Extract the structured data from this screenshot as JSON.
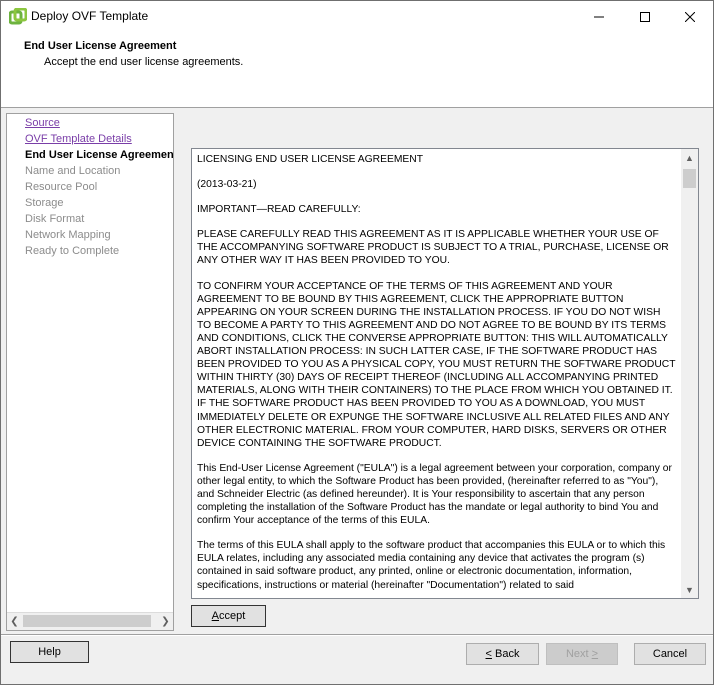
{
  "window": {
    "title": "Deploy OVF Template",
    "icons": {
      "app": "vsphere-logo-icon",
      "minimize": "minimize-icon",
      "maximize": "maximize-icon",
      "close": "close-icon"
    }
  },
  "header": {
    "title": "End User License Agreement",
    "subtitle": "Accept the end user license agreements."
  },
  "sidebar": {
    "items": [
      {
        "label": "Source",
        "state": "link"
      },
      {
        "label": "OVF Template Details",
        "state": "link"
      },
      {
        "label": "End User License Agreement",
        "state": "current"
      },
      {
        "label": "Name and Location",
        "state": "disabled"
      },
      {
        "label": "Resource Pool",
        "state": "disabled"
      },
      {
        "label": "Storage",
        "state": "disabled"
      },
      {
        "label": "Disk Format",
        "state": "disabled"
      },
      {
        "label": "Network Mapping",
        "state": "disabled"
      },
      {
        "label": "Ready to Complete",
        "state": "disabled"
      }
    ]
  },
  "eula": {
    "paragraphs": [
      "LICENSING END USER LICENSE AGREEMENT",
      "(2013-03-21)",
      "IMPORTANT—READ CAREFULLY:",
      "PLEASE CAREFULLY READ THIS AGREEMENT AS IT IS APPLICABLE WHETHER YOUR USE OF THE ACCOMPANYING SOFTWARE PRODUCT IS SUBJECT TO A TRIAL, PURCHASE, LICENSE OR ANY OTHER WAY IT HAS BEEN PROVIDED TO YOU.",
      "TO CONFIRM YOUR ACCEPTANCE OF THE TERMS OF THIS AGREEMENT AND YOUR AGREEMENT TO BE BOUND BY THIS AGREEMENT, CLICK THE APPROPRIATE BUTTON APPEARING ON YOUR SCREEN DURING THE INSTALLATION PROCESS. IF YOU DO NOT WISH TO BECOME A PARTY TO THIS AGREEMENT AND DO NOT AGREE TO BE BOUND BY ITS TERMS AND CONDITIONS, CLICK THE CONVERSE APPROPRIATE BUTTON: THIS WILL AUTOMATICALLY ABORT INSTALLATION PROCESS: IN SUCH LATTER CASE, IF THE SOFTWARE PRODUCT HAS BEEN PROVIDED TO YOU AS A PHYSICAL COPY, YOU MUST RETURN THE SOFTWARE PRODUCT WITHIN THIRTY (30) DAYS OF RECEIPT THEREOF (INCLUDING ALL ACCOMPANYING PRINTED MATERIALS, ALONG WITH THEIR CONTAINERS) TO THE PLACE FROM WHICH YOU OBTAINED IT. IF THE SOFTWARE PRODUCT HAS BEEN PROVIDED TO YOU AS A DOWNLOAD, YOU MUST IMMEDIATELY DELETE OR EXPUNGE THE SOFTWARE INCLUSIVE ALL RELATED FILES AND ANY OTHER ELECTRONIC MATERIAL. FROM YOUR COMPUTER, HARD DISKS, SERVERS OR OTHER DEVICE CONTAINING THE SOFTWARE PRODUCT.",
      "This End-User License Agreement (\"EULA\") is a legal agreement between your corporation, company or other legal entity, to which the Software Product has been provided, (hereinafter referred to as \"You\"), and Schneider Electric (as defined hereunder). It is Your responsibility to ascertain that any person completing the installation of the Software Product has the mandate or legal authority to bind You and confirm Your acceptance of the terms of this EULA.",
      "The terms of this EULA shall apply to the software product that accompanies this EULA or to which this EULA relates, including any associated media containing any device that activates the program (s) contained in said software product, any printed, online or electronic documentation, information, specifications, instructions or material (hereinafter \"Documentation\") related to said"
    ]
  },
  "buttons": {
    "accept_pre": "",
    "accept_u": "A",
    "accept_post": "ccept",
    "help": "Help",
    "back_u": "<",
    "back_post": " Back",
    "next_pre": "Next ",
    "next_u": ">",
    "cancel": "Cancel"
  },
  "colors": {
    "link": "#7a3ea8",
    "disabled_text": "#8c8c8c",
    "default_button_border": "#0078d7",
    "logo_green": "#6db33f"
  }
}
